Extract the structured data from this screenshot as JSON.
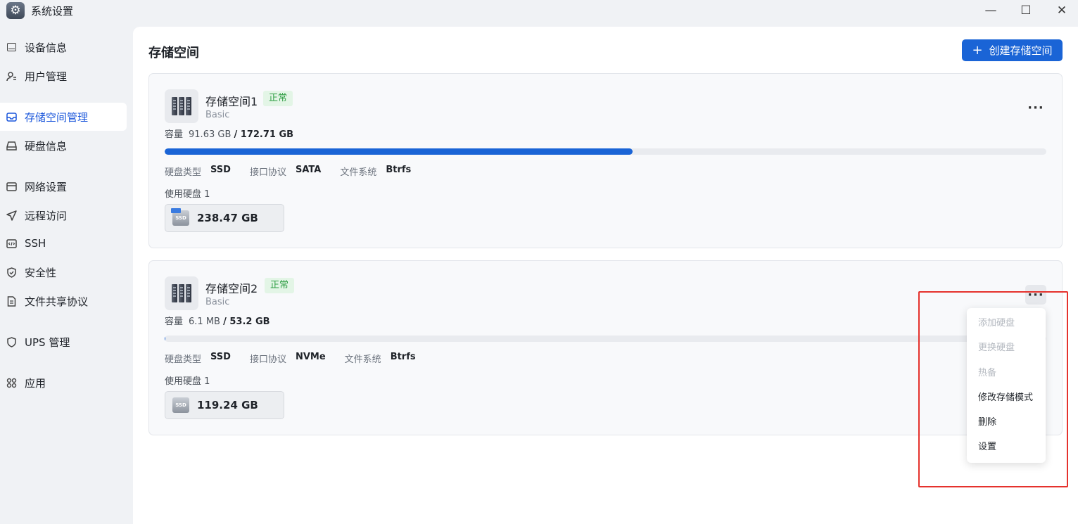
{
  "window": {
    "title": "系统设置",
    "minimize_glyph": "—",
    "maximize_glyph": "☐",
    "close_glyph": "✕"
  },
  "sidebar": {
    "items": [
      {
        "label": "设备信息",
        "icon": "device-icon"
      },
      {
        "label": "用户管理",
        "icon": "user-icon"
      },
      {
        "label": "存储空间管理",
        "icon": "storage-icon",
        "active": true
      },
      {
        "label": "硬盘信息",
        "icon": "hard-disk-icon"
      },
      {
        "label": "网络设置",
        "icon": "network-icon"
      },
      {
        "label": "远程访问",
        "icon": "remote-access-icon"
      },
      {
        "label": "SSH",
        "icon": "ssh-icon"
      },
      {
        "label": "安全性",
        "icon": "shield-icon"
      },
      {
        "label": "文件共享协议",
        "icon": "file-share-icon"
      },
      {
        "label": "UPS 管理",
        "icon": "ups-icon"
      },
      {
        "label": "应用",
        "icon": "apps-icon"
      }
    ]
  },
  "main": {
    "title": "存储空间",
    "create_button": "创建存储空间",
    "volumes": [
      {
        "name": "存储空间1",
        "status": "正常",
        "type": "Basic",
        "capacity_label": "容量",
        "used": "91.63 GB",
        "total": "/ 172.71 GB",
        "usage_fraction": 0.531,
        "disk_type_label": "硬盘类型",
        "disk_type": "SSD",
        "interface_label": "接口协议",
        "interface": "SATA",
        "fs_label": "文件系统",
        "fs": "Btrfs",
        "disks_label": "使用硬盘 1",
        "disk_size": "238.47 GB",
        "disk_icon_text": "SSD"
      },
      {
        "name": "存储空间2",
        "status": "正常",
        "type": "Basic",
        "capacity_label": "容量",
        "used": "6.1 MB",
        "total": "/ 53.2 GB",
        "usage_fraction": 0.001,
        "disk_type_label": "硬盘类型",
        "disk_type": "SSD",
        "interface_label": "接口协议",
        "interface": "NVMe",
        "fs_label": "文件系统",
        "fs": "Btrfs",
        "disks_label": "使用硬盘 1",
        "disk_size": "119.24 GB",
        "disk_icon_text": "SSD"
      }
    ]
  },
  "menu": {
    "more_glyph": "···",
    "items": [
      {
        "label": "添加硬盘",
        "disabled": true
      },
      {
        "label": "更换硬盘",
        "disabled": true
      },
      {
        "label": "热备",
        "disabled": true
      },
      {
        "label": "修改存储模式",
        "disabled": false
      },
      {
        "label": "删除",
        "disabled": false
      },
      {
        "label": "设置",
        "disabled": false
      }
    ]
  },
  "colors": {
    "accent": "#1a64d6",
    "status_green": "#2f9e44",
    "highlight_red": "#e5322d"
  }
}
